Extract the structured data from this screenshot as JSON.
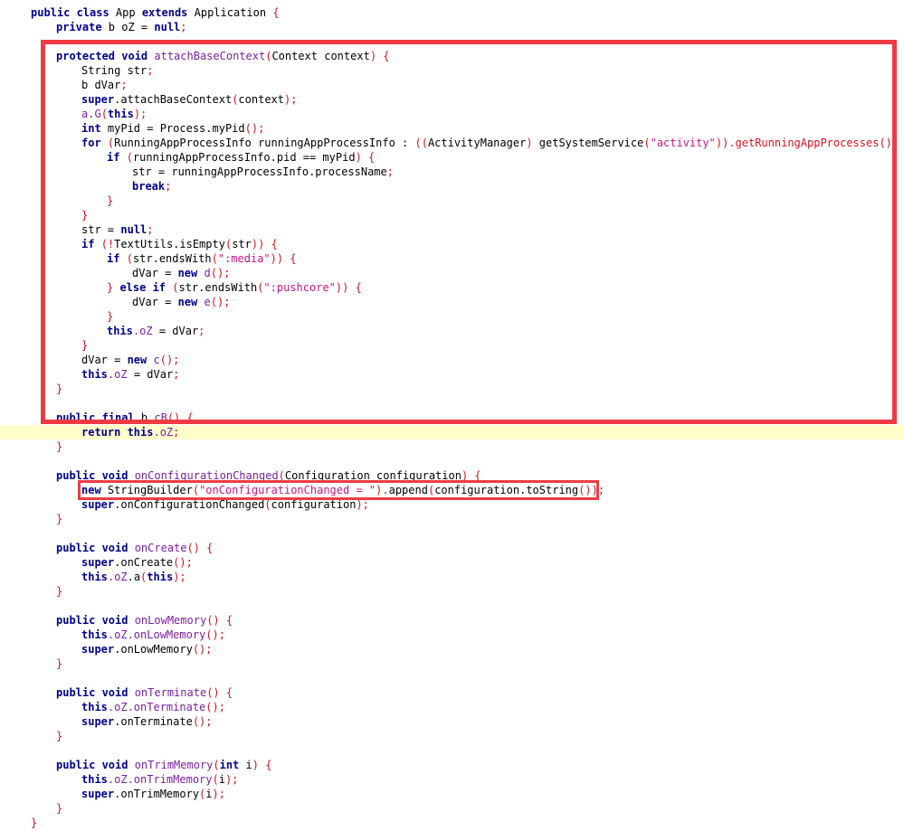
{
  "editor": {
    "highlight_line": 29,
    "colors": {
      "keyword": "#00008b",
      "string": "#c71585",
      "punctuation": "#d4141e",
      "call": "#7a1fa2",
      "highlight": "#ffffcc",
      "annotation_box": "#ee3b43"
    },
    "lines": [
      {
        "indent": 0,
        "tokens": [
          [
            "k",
            "public class "
          ],
          [
            "n",
            "App "
          ],
          [
            "k",
            "extends "
          ],
          [
            "n",
            "Application "
          ],
          [
            "p",
            "{"
          ]
        ]
      },
      {
        "indent": 1,
        "tokens": [
          [
            "k",
            "private "
          ],
          [
            "n",
            "b oZ = "
          ],
          [
            "k",
            "null"
          ],
          [
            "p",
            ";"
          ]
        ]
      },
      {
        "indent": 0,
        "tokens": []
      },
      {
        "indent": 1,
        "tokens": [
          [
            "k",
            "protected void "
          ],
          [
            "f",
            "attachBaseContext"
          ],
          [
            "p",
            "("
          ],
          [
            "n",
            "Context context"
          ],
          [
            "p",
            ") {"
          ]
        ]
      },
      {
        "indent": 2,
        "tokens": [
          [
            "n",
            "String str"
          ],
          [
            "p",
            ";"
          ]
        ]
      },
      {
        "indent": 2,
        "tokens": [
          [
            "n",
            "b dVar"
          ],
          [
            "p",
            ";"
          ]
        ]
      },
      {
        "indent": 2,
        "tokens": [
          [
            "k",
            "super"
          ],
          [
            "n",
            "."
          ],
          [
            "n",
            "attachBaseContext"
          ],
          [
            "p",
            "("
          ],
          [
            "n",
            "context"
          ],
          [
            "p",
            ");"
          ]
        ]
      },
      {
        "indent": 2,
        "tokens": [
          [
            "f",
            "a.G"
          ],
          [
            "p",
            "("
          ],
          [
            "k",
            "this"
          ],
          [
            "p",
            ");"
          ]
        ]
      },
      {
        "indent": 2,
        "tokens": [
          [
            "k",
            "int "
          ],
          [
            "n",
            "myPid = Process.myPid"
          ],
          [
            "p",
            "();"
          ]
        ]
      },
      {
        "indent": 2,
        "tokens": [
          [
            "k",
            "for "
          ],
          [
            "p",
            "("
          ],
          [
            "n",
            "RunningAppProcessInfo runningAppProcessInfo : "
          ],
          [
            "p",
            "(("
          ],
          [
            "n",
            "ActivityManager"
          ],
          [
            "p",
            ") "
          ],
          [
            "n",
            "getSystemService"
          ],
          [
            "p",
            "("
          ],
          [
            "s",
            "\"activity\""
          ],
          [
            "p",
            ")).getRunningAppProcesses()) {"
          ]
        ]
      },
      {
        "indent": 3,
        "tokens": [
          [
            "k",
            "if "
          ],
          [
            "p",
            "("
          ],
          [
            "n",
            "runningAppProcessInfo.pid == myPid"
          ],
          [
            "p",
            ") {"
          ]
        ]
      },
      {
        "indent": 4,
        "tokens": [
          [
            "n",
            "str = runningAppProcessInfo.processName"
          ],
          [
            "p",
            ";"
          ]
        ]
      },
      {
        "indent": 4,
        "tokens": [
          [
            "k",
            "break"
          ],
          [
            "p",
            ";"
          ]
        ]
      },
      {
        "indent": 3,
        "tokens": [
          [
            "p",
            "}"
          ]
        ]
      },
      {
        "indent": 2,
        "tokens": [
          [
            "p",
            "}"
          ]
        ]
      },
      {
        "indent": 2,
        "tokens": [
          [
            "n",
            "str = "
          ],
          [
            "k",
            "null"
          ],
          [
            "p",
            ";"
          ]
        ]
      },
      {
        "indent": 2,
        "tokens": [
          [
            "k",
            "if "
          ],
          [
            "p",
            "(!"
          ],
          [
            "n",
            "TextUtils.isEmpty"
          ],
          [
            "p",
            "("
          ],
          [
            "n",
            "str"
          ],
          [
            "p",
            ")) {"
          ]
        ]
      },
      {
        "indent": 3,
        "tokens": [
          [
            "k",
            "if "
          ],
          [
            "p",
            "("
          ],
          [
            "n",
            "str.endsWith"
          ],
          [
            "p",
            "("
          ],
          [
            "s",
            "\":media\""
          ],
          [
            "p",
            ")) {"
          ]
        ]
      },
      {
        "indent": 4,
        "tokens": [
          [
            "n",
            "dVar = "
          ],
          [
            "k",
            "new "
          ],
          [
            "f",
            "d"
          ],
          [
            "p",
            "();"
          ]
        ]
      },
      {
        "indent": 3,
        "tokens": [
          [
            "p",
            "} "
          ],
          [
            "k",
            "else if "
          ],
          [
            "p",
            "("
          ],
          [
            "n",
            "str.endsWith"
          ],
          [
            "p",
            "("
          ],
          [
            "s",
            "\":pushcore\""
          ],
          [
            "p",
            ")) {"
          ]
        ]
      },
      {
        "indent": 4,
        "tokens": [
          [
            "n",
            "dVar = "
          ],
          [
            "k",
            "new "
          ],
          [
            "f",
            "e"
          ],
          [
            "p",
            "();"
          ]
        ]
      },
      {
        "indent": 3,
        "tokens": [
          [
            "p",
            "}"
          ]
        ]
      },
      {
        "indent": 3,
        "tokens": [
          [
            "k",
            "this"
          ],
          [
            "f",
            ".oZ"
          ],
          [
            "n",
            " = dVar"
          ],
          [
            "p",
            ";"
          ]
        ]
      },
      {
        "indent": 2,
        "tokens": [
          [
            "p",
            "}"
          ]
        ]
      },
      {
        "indent": 2,
        "tokens": [
          [
            "n",
            "dVar = "
          ],
          [
            "k",
            "new "
          ],
          [
            "f",
            "c"
          ],
          [
            "p",
            "();"
          ]
        ]
      },
      {
        "indent": 2,
        "tokens": [
          [
            "k",
            "this"
          ],
          [
            "f",
            ".oZ"
          ],
          [
            "n",
            " = dVar"
          ],
          [
            "p",
            ";"
          ]
        ]
      },
      {
        "indent": 1,
        "tokens": [
          [
            "p",
            "}"
          ]
        ]
      },
      {
        "indent": 0,
        "tokens": []
      },
      {
        "indent": 1,
        "tokens": [
          [
            "k",
            "public final "
          ],
          [
            "n",
            "b "
          ],
          [
            "f",
            "cB"
          ],
          [
            "p",
            "() {"
          ]
        ]
      },
      {
        "indent": 2,
        "tokens": [
          [
            "k",
            "return this"
          ],
          [
            "f",
            ".oZ"
          ],
          [
            "p",
            ";"
          ]
        ]
      },
      {
        "indent": 1,
        "tokens": [
          [
            "p",
            "}"
          ]
        ]
      },
      {
        "indent": 0,
        "tokens": []
      },
      {
        "indent": 1,
        "tokens": [
          [
            "k",
            "public void "
          ],
          [
            "f",
            "onConfigurationChanged"
          ],
          [
            "p",
            "("
          ],
          [
            "n",
            "Configuration configuration"
          ],
          [
            "p",
            ") {"
          ]
        ]
      },
      {
        "indent": 2,
        "tokens": [
          [
            "k",
            "new "
          ],
          [
            "n",
            "StringBuilder"
          ],
          [
            "p",
            "("
          ],
          [
            "s",
            "\"onConfigurationChanged = \""
          ],
          [
            "p",
            ")."
          ],
          [
            "n",
            "append"
          ],
          [
            "p",
            "("
          ],
          [
            "n",
            "configuration.toString"
          ],
          [
            "p",
            "());"
          ]
        ]
      },
      {
        "indent": 2,
        "tokens": [
          [
            "k",
            "super"
          ],
          [
            "n",
            ".onConfigurationChanged"
          ],
          [
            "p",
            "("
          ],
          [
            "n",
            "configuration"
          ],
          [
            "p",
            ");"
          ]
        ]
      },
      {
        "indent": 1,
        "tokens": [
          [
            "p",
            "}"
          ]
        ]
      },
      {
        "indent": 0,
        "tokens": []
      },
      {
        "indent": 1,
        "tokens": [
          [
            "k",
            "public void "
          ],
          [
            "f",
            "onCreate"
          ],
          [
            "p",
            "() {"
          ]
        ]
      },
      {
        "indent": 2,
        "tokens": [
          [
            "k",
            "super"
          ],
          [
            "n",
            ".onCreate"
          ],
          [
            "p",
            "();"
          ]
        ]
      },
      {
        "indent": 2,
        "tokens": [
          [
            "k",
            "this"
          ],
          [
            "f",
            ".oZ"
          ],
          [
            "n",
            ".a"
          ],
          [
            "p",
            "("
          ],
          [
            "k",
            "this"
          ],
          [
            "p",
            ");"
          ]
        ]
      },
      {
        "indent": 1,
        "tokens": [
          [
            "p",
            "}"
          ]
        ]
      },
      {
        "indent": 0,
        "tokens": []
      },
      {
        "indent": 1,
        "tokens": [
          [
            "k",
            "public void "
          ],
          [
            "f",
            "onLowMemory"
          ],
          [
            "p",
            "() {"
          ]
        ]
      },
      {
        "indent": 2,
        "tokens": [
          [
            "k",
            "this"
          ],
          [
            "f",
            ".oZ.onLowMemory"
          ],
          [
            "p",
            "();"
          ]
        ]
      },
      {
        "indent": 2,
        "tokens": [
          [
            "k",
            "super"
          ],
          [
            "n",
            ".onLowMemory"
          ],
          [
            "p",
            "();"
          ]
        ]
      },
      {
        "indent": 1,
        "tokens": [
          [
            "p",
            "}"
          ]
        ]
      },
      {
        "indent": 0,
        "tokens": []
      },
      {
        "indent": 1,
        "tokens": [
          [
            "k",
            "public void "
          ],
          [
            "f",
            "onTerminate"
          ],
          [
            "p",
            "() {"
          ]
        ]
      },
      {
        "indent": 2,
        "tokens": [
          [
            "k",
            "this"
          ],
          [
            "f",
            ".oZ.onTerminate"
          ],
          [
            "p",
            "();"
          ]
        ]
      },
      {
        "indent": 2,
        "tokens": [
          [
            "k",
            "super"
          ],
          [
            "n",
            ".onTerminate"
          ],
          [
            "p",
            "();"
          ]
        ]
      },
      {
        "indent": 1,
        "tokens": [
          [
            "p",
            "}"
          ]
        ]
      },
      {
        "indent": 0,
        "tokens": []
      },
      {
        "indent": 1,
        "tokens": [
          [
            "k",
            "public void "
          ],
          [
            "f",
            "onTrimMemory"
          ],
          [
            "p",
            "("
          ],
          [
            "k",
            "int "
          ],
          [
            "n",
            "i"
          ],
          [
            "p",
            ") {"
          ]
        ]
      },
      {
        "indent": 2,
        "tokens": [
          [
            "k",
            "this"
          ],
          [
            "f",
            ".oZ.onTrimMemory"
          ],
          [
            "p",
            "("
          ],
          [
            "n",
            "i"
          ],
          [
            "p",
            ");"
          ]
        ]
      },
      {
        "indent": 2,
        "tokens": [
          [
            "k",
            "super"
          ],
          [
            "n",
            ".onTrimMemory"
          ],
          [
            "p",
            "("
          ],
          [
            "n",
            "i"
          ],
          [
            "p",
            ");"
          ]
        ]
      },
      {
        "indent": 1,
        "tokens": [
          [
            "p",
            "}"
          ]
        ]
      },
      {
        "indent": 0,
        "tokens": [
          [
            "p",
            "}"
          ]
        ]
      }
    ]
  }
}
